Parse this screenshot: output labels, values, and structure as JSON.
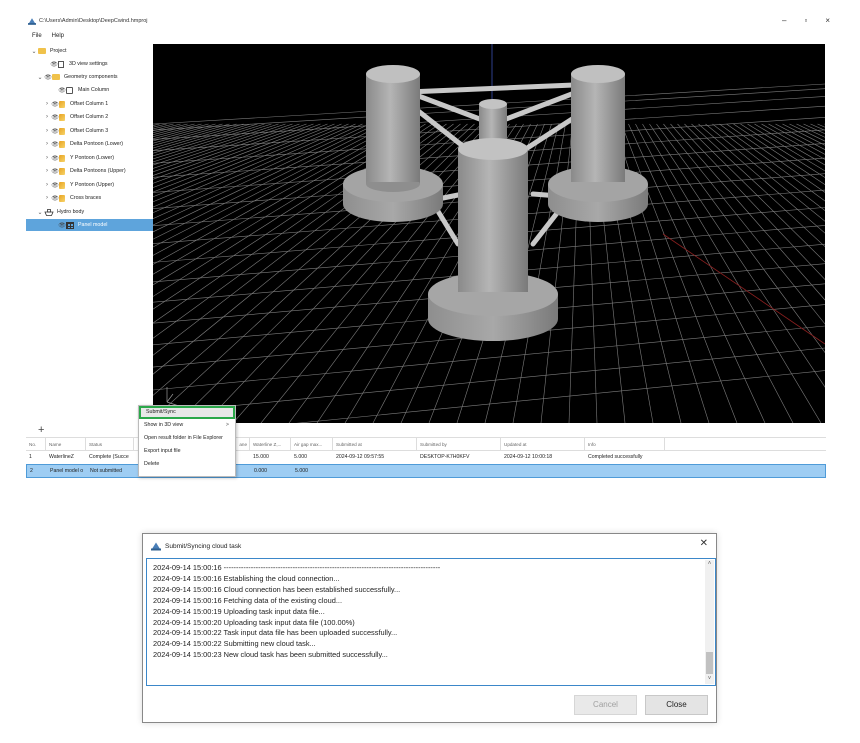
{
  "window": {
    "title": "C:\\Users\\Admin\\Desktop\\DeepCwind.hmproj",
    "minimize": "–",
    "maximize": "▫",
    "close": "×"
  },
  "menu": {
    "file": "File",
    "help": "Help"
  },
  "tree": {
    "project": "Project",
    "view_settings": "3D view settings",
    "geometry_components": "Geometry components",
    "main_column": "Main Column",
    "offset_column_1": "Offset Column 1",
    "offset_column_2": "Offset Column 2",
    "offset_column_3": "Offset Column 3",
    "delta_pontoon_lower": "Delta Pontoon (Lower)",
    "y_pontoon_lower": "Y Pontoon (Lower)",
    "delta_pontoons_upper": "Delta Pontoons (Upper)",
    "y_pontoon_upper": "Y Pontoon (Upper)",
    "cross_braces": "Cross braces",
    "hydro_body": "Hydro body",
    "panel_model": "Panel model"
  },
  "tasks": {
    "add": "+",
    "headers": {
      "no": "No.",
      "name": "Name",
      "status": "Status",
      "plane": "ane",
      "waterline": "Waterline Z,...",
      "airgap": "Air gap max...",
      "submitted_at": "Submitted at",
      "submitted_by": "Submitted by",
      "updated_at": "Updated at",
      "info": "Info"
    },
    "rows": [
      {
        "no": "1",
        "name": "WaterlineZ",
        "status": "Complete (Succe",
        "waterline": "15.000",
        "airgap": "5.000",
        "submitted_at": "2024-09-12 09:57:55",
        "submitted_by": "DESKTOP-K7H0KFV",
        "updated_at": "2024-09-12 10:00:18",
        "info": "Completed successfully"
      },
      {
        "no": "2",
        "name": "Panel model o",
        "status": "Not submitted",
        "waterline": "0.000",
        "airgap": "5.000",
        "submitted_at": "",
        "submitted_by": "",
        "updated_at": "",
        "info": ""
      }
    ]
  },
  "context_menu": {
    "submit_sync": "Submit/Sync",
    "show_in_3d": "Show in 3D view",
    "show_in_3d_arrow": ">",
    "open_folder": "Open result folder in File Explorer",
    "export_input": "Export input file",
    "delete": "Delete"
  },
  "dialog": {
    "title": "Submit/Syncing cloud task",
    "close_x": "✕",
    "log": [
      "2024-09-14 15:00:16 ----------------------------------------------------------------------------------------",
      "2024-09-14 15:00:16 Establishing the cloud connection...",
      "2024-09-14 15:00:16 Cloud connection has been established successfully...",
      "2024-09-14 15:00:16 Fetching data of the existing cloud...",
      "2024-09-14 15:00:19 Uploading task input data file...",
      "2024-09-14 15:00:20 Uploading task input data file (100.00%)",
      "2024-09-14 15:00:22 Task input data file has been uploaded successfully...",
      "2024-09-14 15:00:22 Submitting new cloud task...",
      "2024-09-14 15:00:23 New cloud task has been submitted successfully..."
    ],
    "cancel": "Cancel",
    "close": "Close"
  }
}
